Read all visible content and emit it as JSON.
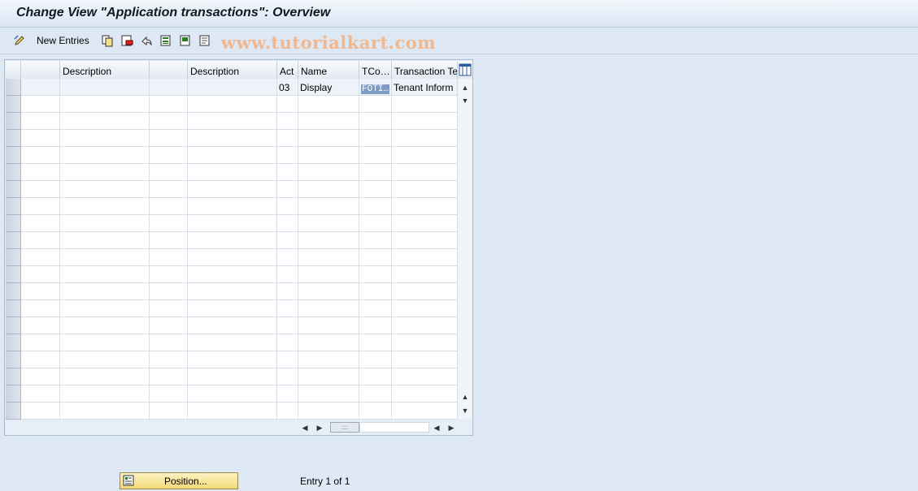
{
  "window": {
    "title": "Change View \"Application transactions\": Overview"
  },
  "toolbar": {
    "new_entries_label": "New Entries",
    "icons": [
      "edit-pencil-icon",
      "copy-icon",
      "delete-icon",
      "undo-icon",
      "select-all-icon",
      "select-block-icon",
      "deselect-all-icon"
    ],
    "watermark": "www.tutorialkart.com"
  },
  "table": {
    "columns": [
      "",
      "Description",
      "",
      "Description",
      "Act",
      "Name",
      "TCo…",
      "Transaction Te"
    ],
    "rows": [
      [
        "",
        "",
        "",
        "",
        "03",
        "Display",
        "FOTI…",
        "Tenant Inform"
      ]
    ],
    "empty_row_count": 19
  },
  "footer": {
    "position_label": "Position...",
    "entry_text": "Entry 1 of 1"
  }
}
